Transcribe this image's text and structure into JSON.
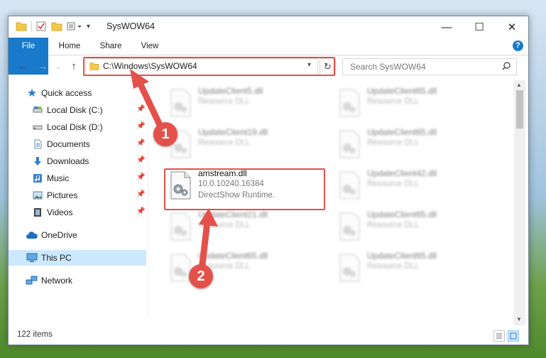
{
  "window": {
    "title": "SysWOW64",
    "controls": {
      "minimize": "—",
      "maximize": "☐",
      "close": "✕"
    }
  },
  "ribbon": {
    "tabs": [
      {
        "label": "File",
        "active": true
      },
      {
        "label": "Home"
      },
      {
        "label": "Share"
      },
      {
        "label": "View"
      }
    ],
    "help_label": "?"
  },
  "nav": {
    "address": "C:\\Windows\\SysWOW64",
    "search_placeholder": "Search SysWOW64"
  },
  "sidebar": {
    "items": [
      {
        "label": "Quick access",
        "icon": "star-icon",
        "pinned": false
      },
      {
        "label": "Local Disk (C:)",
        "icon": "drive-icon",
        "pinned": true
      },
      {
        "label": "Local Disk (D:)",
        "icon": "drive-icon",
        "pinned": true
      },
      {
        "label": "Documents",
        "icon": "documents-icon",
        "pinned": true
      },
      {
        "label": "Downloads",
        "icon": "download-icon",
        "pinned": true
      },
      {
        "label": "Music",
        "icon": "music-icon",
        "pinned": true
      },
      {
        "label": "Pictures",
        "icon": "pictures-icon",
        "pinned": true
      },
      {
        "label": "Videos",
        "icon": "videos-icon",
        "pinned": true
      },
      {
        "label": "OneDrive",
        "icon": "cloud-icon",
        "pinned": false
      },
      {
        "label": "This PC",
        "icon": "computer-icon",
        "pinned": false,
        "selected": true
      },
      {
        "label": "Network",
        "icon": "network-icon",
        "pinned": false
      }
    ]
  },
  "files": [
    {
      "name": "UpdateClient5.dll",
      "type": "Resource DLL",
      "blurred": true
    },
    {
      "name": "UpdateClient65.dll",
      "type": "Resource DLL",
      "blurred": true
    },
    {
      "name": "UpdateClient19.dll",
      "type": "Resource DLL",
      "blurred": true
    },
    {
      "name": "UpdateClient65.dll",
      "type": "Resource DLL",
      "blurred": true
    },
    {
      "name": "amstream.dll",
      "version": "10.0.10240.16384",
      "type": "DirectShow Runtime.",
      "blurred": false,
      "highlighted": true
    },
    {
      "name": "UpdateClient42.dll",
      "type": "Resource DLL",
      "blurred": true
    },
    {
      "name": "UpdateClient21.dll",
      "type": "Resource DLL",
      "blurred": true
    },
    {
      "name": "UpdateClient65.dll",
      "type": "Resource DLL",
      "blurred": true
    },
    {
      "name": "UpdateClient65.dll",
      "type": "Resource DLL",
      "blurred": true
    },
    {
      "name": "UpdateClient65.dll",
      "type": "Resource DLL",
      "blurred": true
    }
  ],
  "status": {
    "item_count": "122 items"
  },
  "annotations": [
    {
      "label": "1",
      "target": "address-bar"
    },
    {
      "label": "2",
      "target": "amstream.dll"
    }
  ],
  "colors": {
    "accent": "#1979ca",
    "annotation": "#e4514b",
    "selection": "#cce8ff"
  }
}
